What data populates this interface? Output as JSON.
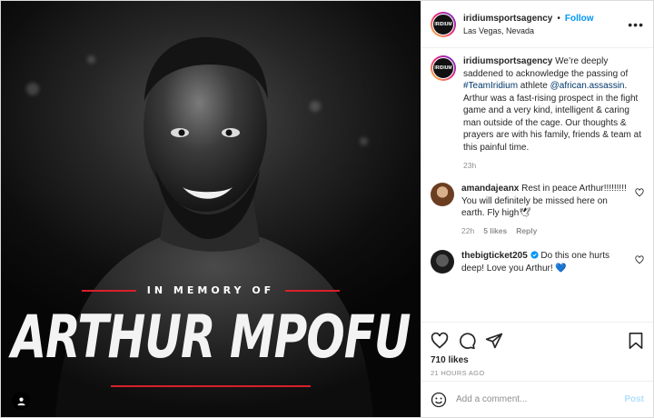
{
  "poster": {
    "username": "iridiumsportsagency",
    "follow_label": "Follow",
    "location": "Las Vegas, Nevada",
    "avatar_text": "IRIDIUM",
    "more_icon": "more-horizontal-icon"
  },
  "image": {
    "memory_text": "IN MEMORY OF",
    "name_text": "ARTHUR MPOFU",
    "accent_color": "#d8202b",
    "tag_icon": "user-tag-icon"
  },
  "caption": {
    "username": "iridiumsportsagency",
    "text_before_hashtag": " We’re deeply saddened to acknowledge the passing of ",
    "hashtag": "#TeamIridium",
    "text_after_hashtag": " athlete ",
    "mention": "@african.assassin",
    "text_after_mention": ". Arthur was a fast-rising prospect in the fight game and a very kind, intelligent & caring man outside of the cage. Our thoughts & prayers are with his family, friends & team at this painful time.",
    "time": "23h"
  },
  "comments": [
    {
      "username": "amandajeanx",
      "text": " Rest in peace Arthur!!!!!!!!! You will definitely be missed here on earth. Fly high🕊",
      "time": "22h",
      "likes": "5 likes",
      "reply_label": "Reply"
    },
    {
      "username": "thebigticket205",
      "text": " Do this one hurts deep! Love you Arthur! 💙",
      "verified_icon": "verified-badge-icon"
    }
  ],
  "actions": {
    "like_icon": "heart-icon",
    "comment_icon": "comment-icon",
    "share_icon": "share-icon",
    "save_icon": "bookmark-icon",
    "likes_label": "710 likes",
    "posted_ago": "21 HOURS AGO"
  },
  "add_comment": {
    "placeholder": "Add a comment...",
    "post_label": "Post",
    "emoji_icon": "emoji-icon"
  },
  "colors": {
    "link": "#00376b",
    "follow": "#0095f6",
    "muted": "#8e8e8e"
  }
}
